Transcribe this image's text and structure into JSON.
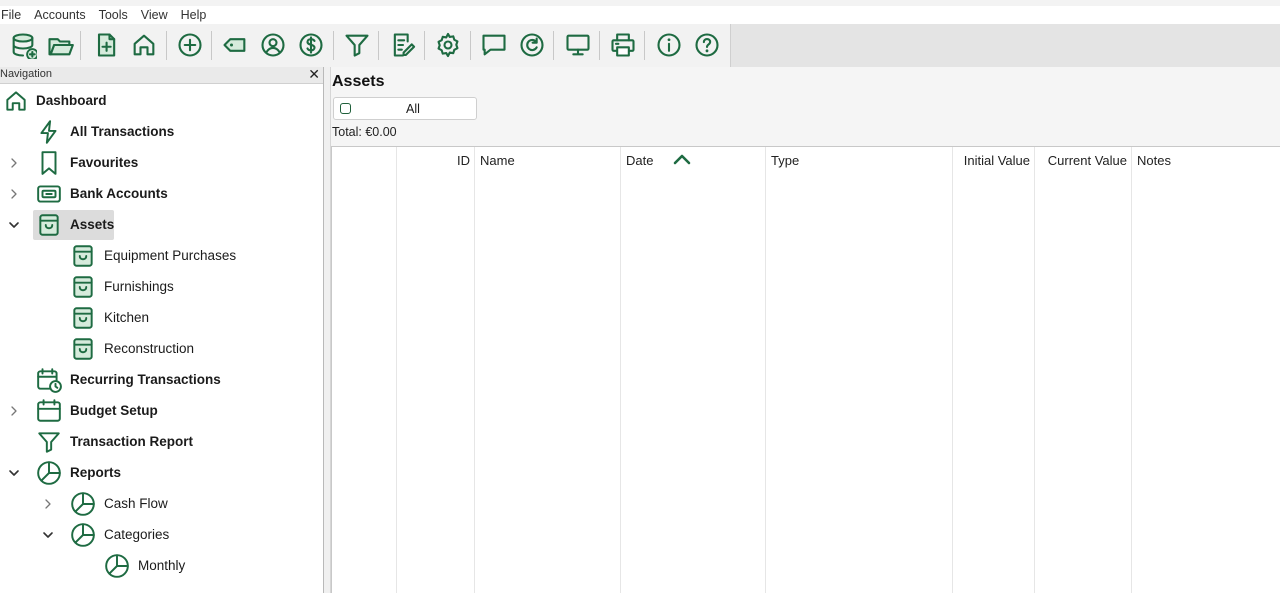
{
  "menu": [
    "File",
    "Accounts",
    "Tools",
    "View",
    "Help"
  ],
  "toolbar": {
    "buttons": [
      {
        "name": "database-add-icon"
      },
      {
        "name": "folder-open-icon"
      },
      {
        "name": "new-document-icon"
      },
      {
        "name": "home-icon"
      },
      {
        "name": "add-circle-icon"
      },
      {
        "name": "tag-icon"
      },
      {
        "name": "user-icon"
      },
      {
        "name": "dollar-icon"
      },
      {
        "name": "filter-icon"
      },
      {
        "name": "edit-note-icon"
      },
      {
        "name": "settings-gear-icon"
      },
      {
        "name": "chat-icon"
      },
      {
        "name": "refresh-icon"
      },
      {
        "name": "monitor-icon"
      },
      {
        "name": "print-icon"
      },
      {
        "name": "info-icon"
      },
      {
        "name": "help-icon"
      }
    ]
  },
  "navigation": {
    "title": "Navigation",
    "close": "✕",
    "items": [
      {
        "label": "Dashboard",
        "icon": "home-icon",
        "bold": true
      },
      {
        "label": "All Transactions",
        "icon": "lightning-icon",
        "bold": true
      },
      {
        "label": "Favourites",
        "icon": "bookmark-icon",
        "bold": true,
        "expander": "collapsed"
      },
      {
        "label": "Bank Accounts",
        "icon": "bank-card-icon",
        "bold": true,
        "expander": "collapsed"
      },
      {
        "label": "Assets",
        "icon": "box-icon",
        "bold": true,
        "expander": "expanded",
        "selected": true
      },
      {
        "label": "Equipment Purchases",
        "icon": "box-icon"
      },
      {
        "label": "Furnishings",
        "icon": "box-icon"
      },
      {
        "label": "Kitchen",
        "icon": "box-icon"
      },
      {
        "label": "Reconstruction",
        "icon": "box-icon"
      },
      {
        "label": "Recurring Transactions",
        "icon": "calendar-clock-icon",
        "bold": true
      },
      {
        "label": "Budget Setup",
        "icon": "calendar-icon",
        "bold": true,
        "expander": "collapsed"
      },
      {
        "label": "Transaction Report",
        "icon": "filter-icon",
        "bold": true
      },
      {
        "label": "Reports",
        "icon": "pie-chart-icon",
        "bold": true,
        "expander": "expanded"
      },
      {
        "label": "Cash Flow",
        "icon": "pie-chart-icon",
        "expander": "collapsed"
      },
      {
        "label": "Categories",
        "icon": "pie-chart-icon",
        "expander": "expanded"
      },
      {
        "label": "Monthly",
        "icon": "pie-chart-icon"
      }
    ]
  },
  "main": {
    "title": "Assets",
    "filter_label": "All",
    "total": "Total: €0.00",
    "columns": [
      "ID",
      "Name",
      "Date",
      "Type",
      "Initial Value",
      "Current Value",
      "Notes"
    ],
    "sort_column": "Date",
    "sort_direction": "ascending"
  },
  "colors": {
    "accent": "#1e6b42",
    "icon_fill": "#d6ebdc"
  }
}
